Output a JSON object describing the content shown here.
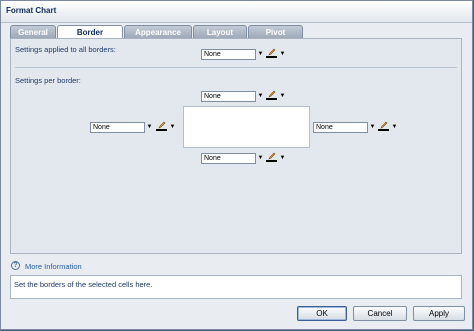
{
  "window": {
    "title": "Format Chart"
  },
  "tabs": [
    {
      "label": "General"
    },
    {
      "label": "Border"
    },
    {
      "label": "Appearance"
    },
    {
      "label": "Layout"
    },
    {
      "label": "Pivot"
    }
  ],
  "border": {
    "all_label": "Settings applied to all borders:",
    "per_label": "Settings per border:",
    "all_value": "None",
    "top_value": "None",
    "left_value": "None",
    "right_value": "None",
    "bottom_value": "None"
  },
  "info": {
    "link": "More Information",
    "text": "Set the borders of the selected cells here."
  },
  "buttons": {
    "ok": "OK",
    "cancel": "Cancel",
    "apply": "Apply"
  },
  "icons": {
    "info": "?",
    "caret": "▼"
  },
  "colors": {
    "accent": "#285ca8",
    "title": "#0b2a5c"
  }
}
